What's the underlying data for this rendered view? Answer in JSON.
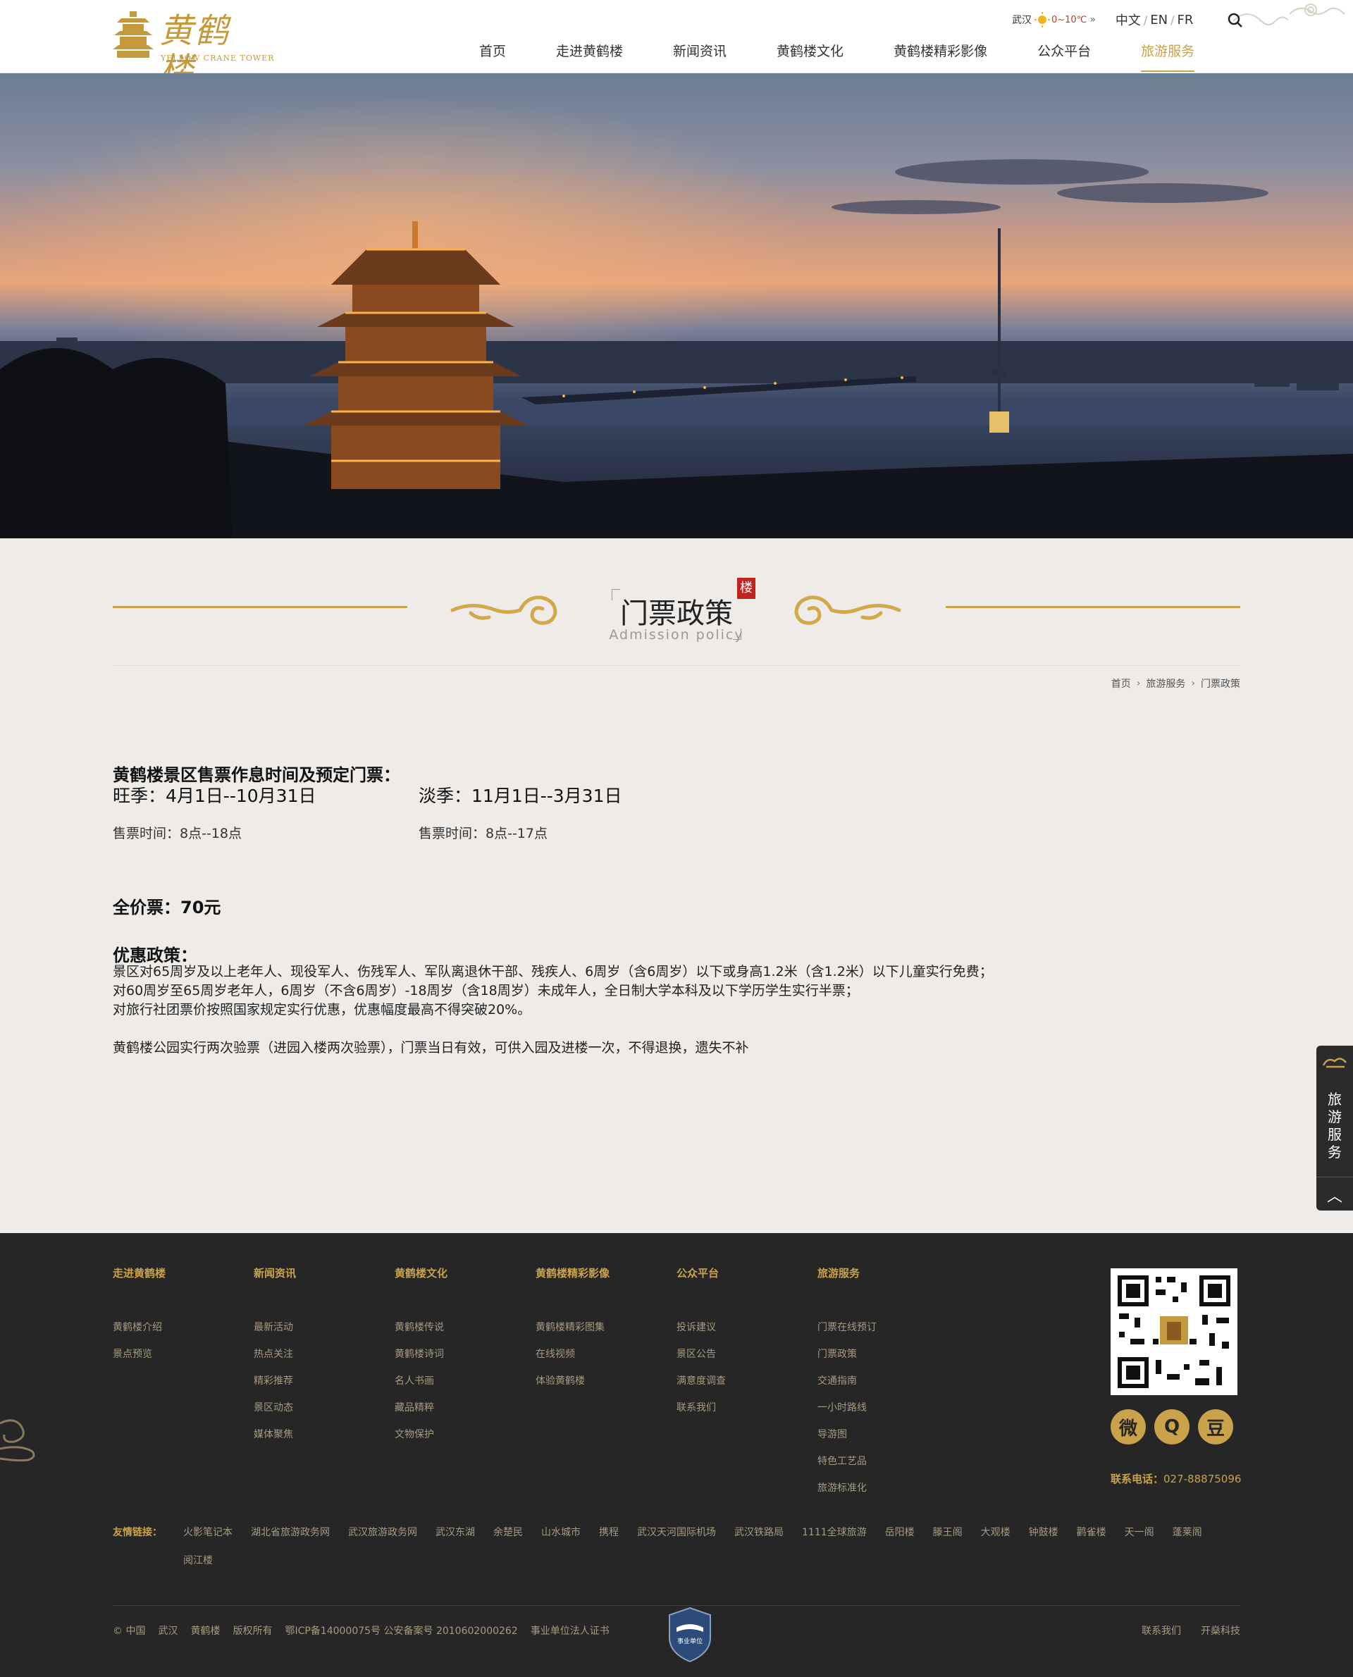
{
  "header": {
    "logo_cn": "黄鹤楼",
    "logo_en": "YELLOW CRANE TOWER",
    "weather_city": "武汉",
    "weather_temp": "0~10℃",
    "weather_more": "»",
    "lang_cn": "中文",
    "lang_en": "EN",
    "lang_fr": "FR",
    "nav": [
      "首页",
      "走进黄鹤楼",
      "新闻资讯",
      "黄鹤楼文化",
      "黄鹤楼精彩影像",
      "公众平台",
      "旅游服务"
    ],
    "nav_active_index": 6
  },
  "title": {
    "cn": "门票政策",
    "en": "Admission policy",
    "seal": "楼"
  },
  "breadcrumb": [
    "首页",
    "旅游服务",
    "门票政策"
  ],
  "content": {
    "heading": "黄鹤楼景区售票作息时间及预定门票：",
    "peak": "旺季：4月1日--10月31日",
    "off": "淡季：11月1日--3月31日",
    "peak_time": "售票时间：8点--18点",
    "off_time": "售票时间：8点--17点",
    "full_price": "全价票：70元",
    "discount_heading": "优惠政策：",
    "discount_lines": [
      "景区对65周岁及以上老年人、现役军人、伤残军人、军队离退休干部、残疾人、6周岁（含6周岁）以下或身高1.2米（含1.2米）以下儿童实行免费；",
      "对60周岁至65周岁老年人，6周岁（不含6周岁）-18周岁（含18周岁）未成年人，全日制大学本科及以下学历学生实行半票；",
      "对旅行社团票价按照国家规定实行优惠，优惠幅度最高不得突破20%。"
    ],
    "note": "黄鹤楼公园实行两次验票（进园入楼两次验票），门票当日有效，可供入园及进楼一次，不得退换，遗失不补"
  },
  "side_widget": {
    "label": [
      "旅",
      "游",
      "服",
      "务"
    ],
    "up": "︿"
  },
  "footer": {
    "columns": [
      {
        "title": "走进黄鹤楼",
        "links": [
          "黄鹤楼介绍",
          "景点预览"
        ]
      },
      {
        "title": "新闻资讯",
        "links": [
          "最新活动",
          "热点关注",
          "精彩推荐",
          "景区动态",
          "媒体聚焦"
        ]
      },
      {
        "title": "黄鹤楼文化",
        "links": [
          "黄鹤楼传说",
          "黄鹤楼诗词",
          "名人书画",
          "藏品精粹",
          "文物保护"
        ]
      },
      {
        "title": "黄鹤楼精彩影像",
        "links": [
          "黄鹤楼精彩图集",
          "在线视频",
          "体验黄鹤楼"
        ]
      },
      {
        "title": "公众平台",
        "links": [
          "投诉建议",
          "景区公告",
          "满意度调查",
          "联系我们"
        ]
      },
      {
        "title": "旅游服务",
        "links": [
          "门票在线预订",
          "门票政策",
          "交通指南",
          "一小时路线",
          "导游图",
          "特色工艺品",
          "旅游标准化"
        ]
      }
    ],
    "social": [
      "微",
      "Q",
      "豆"
    ],
    "phone_label": "联系电话：",
    "phone": "027-88875096",
    "friend_label": "友情链接：",
    "friend_links": [
      "火影笔记本",
      "湖北省旅游政务网",
      "武汉旅游政务网",
      "武汉东湖",
      "余楚民",
      "山水城市",
      "携程",
      "武汉天河国际机场",
      "武汉铁路局",
      "1111全球旅游",
      "岳阳楼",
      "滕王阁",
      "大观楼",
      "钟鼓楼",
      "鹳雀楼",
      "天一阁",
      "蓬莱阁",
      "阅江楼"
    ],
    "copyright": [
      "©  中国",
      "武汉",
      "黄鹤楼",
      "版权所有",
      "鄂ICP备14000075号 公安备案号 2010602000262",
      "事业单位法人证书"
    ],
    "right_links": [
      "联系我们",
      "开燊科技"
    ],
    "badge": "事业单位"
  }
}
